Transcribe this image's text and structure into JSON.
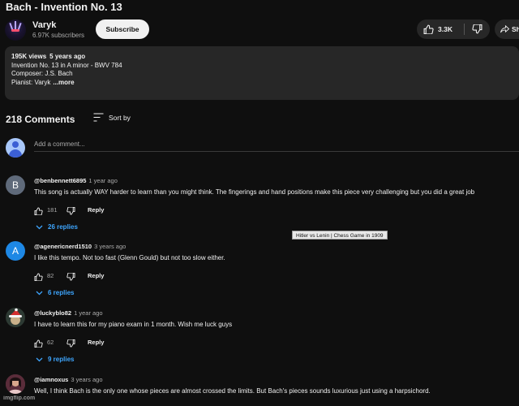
{
  "video": {
    "title": "Bach - Invention No. 13"
  },
  "channel": {
    "name": "Varyk",
    "subscribers": "6.97K subscribers",
    "subscribe_label": "Subscribe"
  },
  "actions": {
    "like_count": "3.3K",
    "share_label": "Sh"
  },
  "description": {
    "views": "195K views",
    "age": "5 years ago",
    "line1": "Invention No. 13 in A minor - BWV 784",
    "line2": "Composer: J.S. Bach",
    "line3_prefix": "Pianist: Varyk",
    "more": "...more"
  },
  "comments": {
    "count_label": "218 Comments",
    "sort_label": "Sort by",
    "add_placeholder": "Add a comment...",
    "reply_label": "Reply",
    "items": [
      {
        "avatar_letter": "B",
        "avatar_color": "#5f6a7a",
        "author": "@benbennett6895",
        "time": "1 year ago",
        "text": "This song is actually WAY harder to learn than you might think. The fingerings and hand positions make this piece very challenging but you did a great job",
        "likes": "181",
        "replies": "26 replies"
      },
      {
        "avatar_letter": "A",
        "avatar_color": "#1e88e5",
        "author": "@agenericnerd1510",
        "time": "3 years ago",
        "text": "I like this tempo. Not too fast (Glenn Gould) but not too slow either.",
        "likes": "82",
        "replies": "6 replies"
      },
      {
        "avatar_letter": "",
        "avatar_color": "#2d3a33",
        "author": "@luckyblo82",
        "time": "1 year ago",
        "text": "I have to learn this for my piano exam in 1 month. Wish me luck guys",
        "likes": "62",
        "replies": "9 replies"
      },
      {
        "avatar_letter": "",
        "avatar_color": "#6a3d4a",
        "author": "@iamnoxus",
        "time": "3 years ago",
        "text": "Well, I think Bach is the only one whose pieces are almost crossed the limits. But Bach's pieces sounds luxurious just using a harpsichord.",
        "likes": "",
        "replies": ""
      }
    ]
  },
  "tooltip": {
    "text": "Hitler vs Lenin | Chess Game in 1909"
  },
  "watermark": {
    "text": "imgflip.com"
  }
}
